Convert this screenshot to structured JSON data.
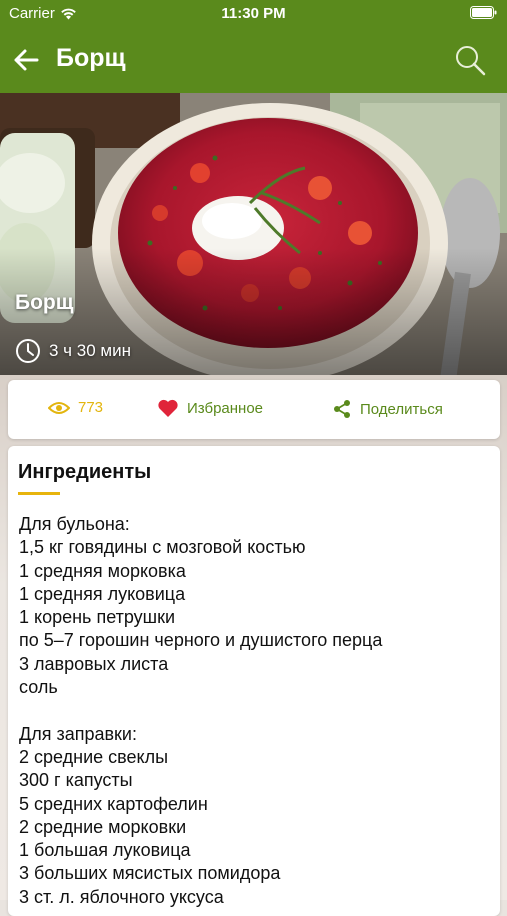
{
  "status_bar": {
    "carrier": "Carrier",
    "time": "11:30 PM"
  },
  "nav": {
    "title": "Борщ",
    "back_icon": "arrow-left-icon",
    "search_icon": "search-icon"
  },
  "hero": {
    "title": "Борщ",
    "cook_time": "3 ч 30 мин"
  },
  "actions": {
    "views": "773",
    "favorite": "Избранное",
    "share": "Поделиться"
  },
  "ingredients": {
    "heading": "Ингредиенты",
    "lines": [
      "Для бульона:",
      "1,5 кг говядины с мозговой костью",
      "1 средняя морковка",
      "1 средняя луковица",
      "1 корень петрушки",
      "по 5–7 горошин черного и душистого перца",
      "3 лавровых листа",
      "соль",
      "",
      "Для заправки:",
      "2 средние свеклы",
      "300 г капусты",
      "5 средних картофелин",
      "2 средние морковки",
      "1 большая луковица",
      "3 больших мясистых помидора",
      "3 ст. л. яблочного уксуса"
    ]
  },
  "colors": {
    "brand_green": "#5a8a1c",
    "accent_yellow": "#e3b50e",
    "heart_red": "#e0243a"
  }
}
